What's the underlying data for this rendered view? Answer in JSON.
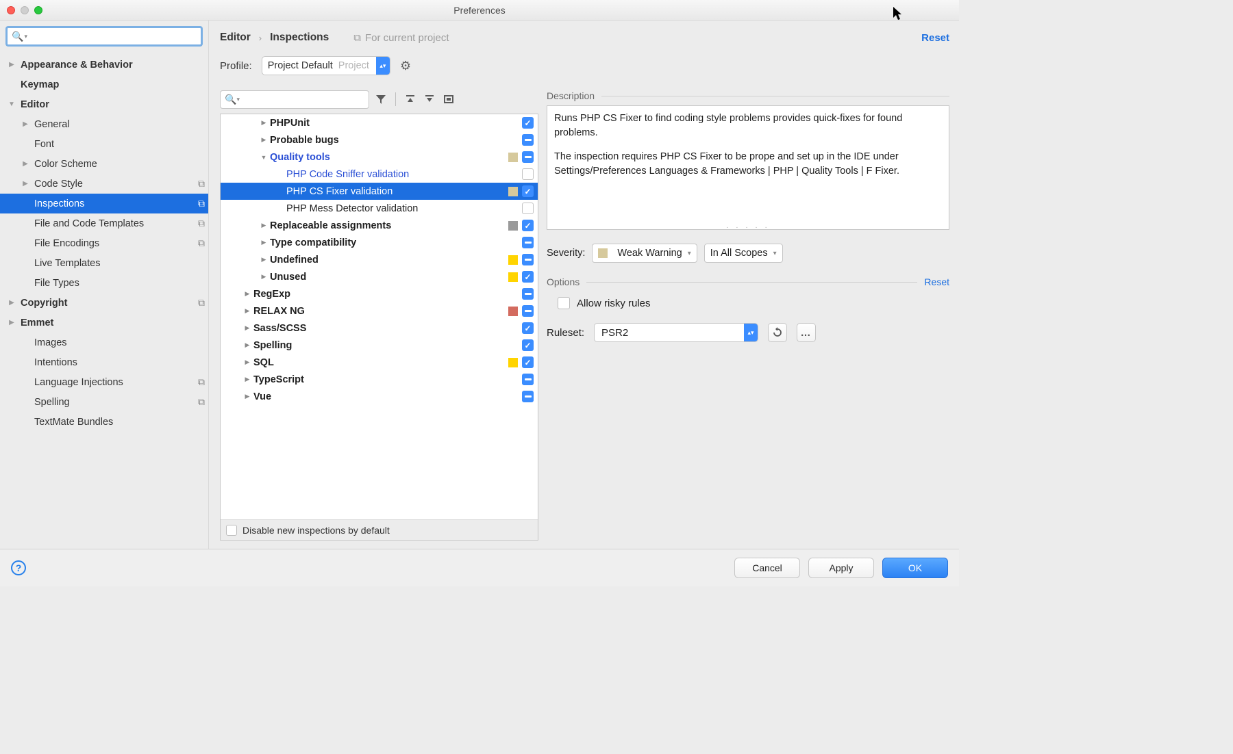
{
  "window": {
    "title": "Preferences"
  },
  "sidebar": {
    "items": [
      {
        "label": "Appearance & Behavior",
        "depth": 0,
        "twisty": "right",
        "bold": true
      },
      {
        "label": "Keymap",
        "depth": 0,
        "twisty": "",
        "bold": true
      },
      {
        "label": "Editor",
        "depth": 0,
        "twisty": "down",
        "bold": true
      },
      {
        "label": "General",
        "depth": 1,
        "twisty": "right"
      },
      {
        "label": "Font",
        "depth": 1
      },
      {
        "label": "Color Scheme",
        "depth": 1,
        "twisty": "right"
      },
      {
        "label": "Code Style",
        "depth": 1,
        "twisty": "right",
        "stack": true
      },
      {
        "label": "Inspections",
        "depth": 1,
        "selected": true,
        "stack": true
      },
      {
        "label": "File and Code Templates",
        "depth": 1,
        "stack": true
      },
      {
        "label": "File Encodings",
        "depth": 1,
        "stack": true
      },
      {
        "label": "Live Templates",
        "depth": 1
      },
      {
        "label": "File Types",
        "depth": 1
      },
      {
        "label": "Copyright",
        "depth": 0,
        "twisty": "right",
        "bold": true,
        "stack": true
      },
      {
        "label": "Emmet",
        "depth": 0,
        "twisty": "right",
        "bold": true
      },
      {
        "label": "Images",
        "depth": 1
      },
      {
        "label": "Intentions",
        "depth": 1
      },
      {
        "label": "Language Injections",
        "depth": 1,
        "stack": true
      },
      {
        "label": "Spelling",
        "depth": 1,
        "stack": true
      },
      {
        "label": "TextMate Bundles",
        "depth": 1
      }
    ]
  },
  "breadcrumb": {
    "a": "Editor",
    "b": "Inspections",
    "for_project": "For current project"
  },
  "reset_label": "Reset",
  "profile": {
    "label": "Profile:",
    "value": "Project Default",
    "scope": "Project"
  },
  "tree": {
    "rows": [
      {
        "label": "PHPUnit",
        "depth": 2,
        "twisty": "right",
        "bold": true,
        "check": "on"
      },
      {
        "label": "Probable bugs",
        "depth": 2,
        "twisty": "right",
        "bold": true,
        "check": "dash"
      },
      {
        "label": "Quality tools",
        "depth": 2,
        "twisty": "down",
        "bold": true,
        "link": true,
        "swatch": "tan",
        "check": "dash"
      },
      {
        "label": "PHP Code Sniffer validation",
        "depth": 3,
        "link": true,
        "check": "off"
      },
      {
        "label": "PHP CS Fixer validation",
        "depth": 3,
        "selected": true,
        "swatch": "tan",
        "check": "on"
      },
      {
        "label": "PHP Mess Detector validation",
        "depth": 3,
        "check": "off"
      },
      {
        "label": "Replaceable assignments",
        "depth": 2,
        "twisty": "right",
        "bold": true,
        "swatch": "gray",
        "check": "on"
      },
      {
        "label": "Type compatibility",
        "depth": 2,
        "twisty": "right",
        "bold": true,
        "check": "dash"
      },
      {
        "label": "Undefined",
        "depth": 2,
        "twisty": "right",
        "bold": true,
        "swatch": "yel",
        "check": "dash"
      },
      {
        "label": "Unused",
        "depth": 2,
        "twisty": "right",
        "bold": true,
        "swatch": "yel",
        "check": "on"
      },
      {
        "label": "RegExp",
        "depth": 1,
        "twisty": "right",
        "bold": true,
        "check": "dash"
      },
      {
        "label": "RELAX NG",
        "depth": 1,
        "twisty": "right",
        "bold": true,
        "swatch": "red",
        "check": "dash"
      },
      {
        "label": "Sass/SCSS",
        "depth": 1,
        "twisty": "right",
        "bold": true,
        "check": "on"
      },
      {
        "label": "Spelling",
        "depth": 1,
        "twisty": "right",
        "bold": true,
        "check": "on"
      },
      {
        "label": "SQL",
        "depth": 1,
        "twisty": "right",
        "bold": true,
        "swatch": "yel",
        "check": "on"
      },
      {
        "label": "TypeScript",
        "depth": 1,
        "twisty": "right",
        "bold": true,
        "check": "dash"
      },
      {
        "label": "Vue",
        "depth": 1,
        "twisty": "right",
        "bold": true,
        "check": "dash"
      }
    ],
    "footer": "Disable new inspections by default"
  },
  "detail": {
    "description_header": "Description",
    "p1": "Runs PHP CS Fixer to find coding style problems provides quick-fixes for found problems.",
    "p2": "The inspection requires PHP CS Fixer to be prope and set up in the IDE under Settings/Preferences Languages & Frameworks | PHP | Quality Tools | F Fixer.",
    "severity_label": "Severity:",
    "severity_value": "Weak Warning",
    "scopes_value": "In All Scopes",
    "options_header": "Options",
    "options_reset": "Reset",
    "allow_risky": "Allow risky rules",
    "ruleset_label": "Ruleset:",
    "ruleset_value": "PSR2"
  },
  "buttons": {
    "cancel": "Cancel",
    "apply": "Apply",
    "ok": "OK"
  }
}
